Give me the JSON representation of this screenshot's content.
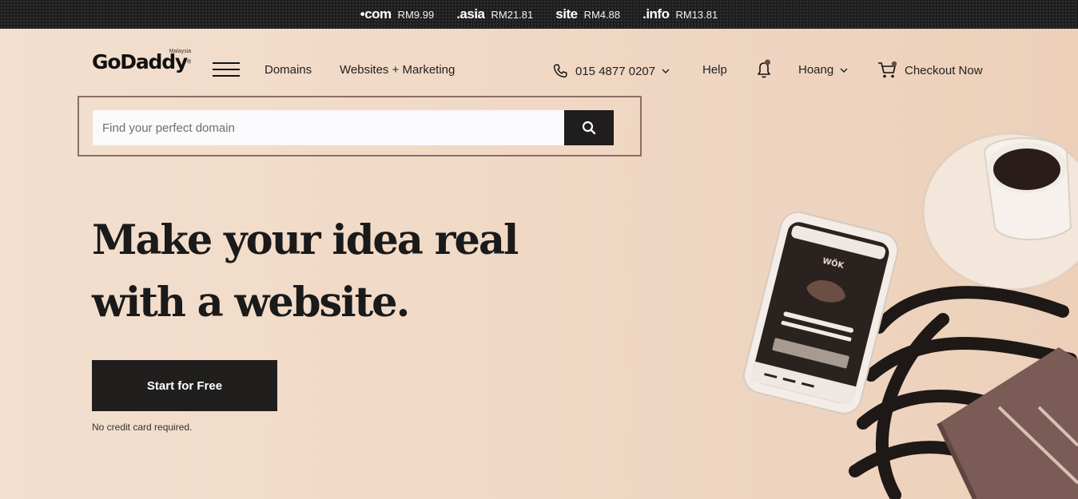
{
  "promo_bar": {
    "items": [
      {
        "tld": "•com",
        "price": "RM9.99"
      },
      {
        "tld": ".asia",
        "price": "RM21.81"
      },
      {
        "tld": "site",
        "price": "RM4.88"
      },
      {
        "tld": ".info",
        "price": "RM13.81"
      }
    ]
  },
  "header": {
    "logo_text": "GoDaddy",
    "logo_region": "Malaysia",
    "nav": {
      "domains": "Domains",
      "websites_marketing": "Websites + Marketing"
    },
    "phone": "015 4877 0207",
    "help": "Help",
    "user": "Hoang",
    "checkout": "Checkout Now"
  },
  "search": {
    "placeholder": "Find your perfect domain",
    "value": ""
  },
  "hero": {
    "headline": "Make your idea real with a website.",
    "cta_label": "Start for Free",
    "note": "No credit card required.",
    "phone_screen_brand": "WÖK"
  },
  "colors": {
    "hero_bg": "#f1dccb",
    "dark": "#211e1e",
    "search_border": "#8c6d64"
  },
  "icons": [
    "menu-icon",
    "phone-icon",
    "chevron-down-icon",
    "bell-icon",
    "cart-icon",
    "search-icon"
  ]
}
